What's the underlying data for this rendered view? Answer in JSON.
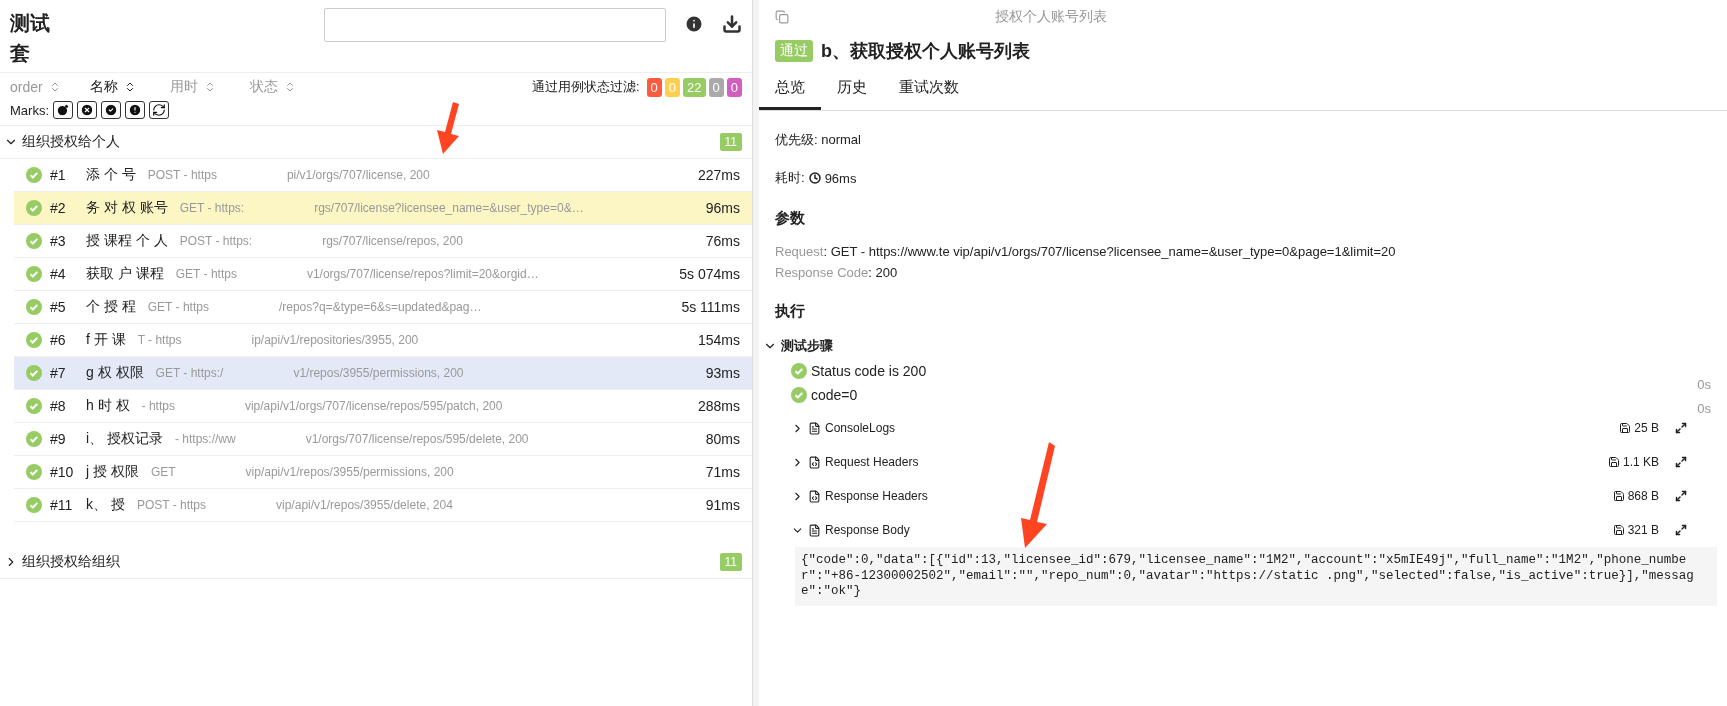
{
  "left": {
    "title": "测试套",
    "sort_columns": [
      {
        "label": "order",
        "selected": false
      },
      {
        "label": "名称",
        "selected": true
      },
      {
        "label": "用时",
        "selected": false
      },
      {
        "label": "状态",
        "selected": false
      }
    ],
    "filter_label": "通过用例状态过滤:",
    "filters": [
      {
        "count": "0",
        "color": "#fd5a3e"
      },
      {
        "count": "0",
        "color": "#ffd050"
      },
      {
        "count": "22",
        "color": "#97cc64"
      },
      {
        "count": "0",
        "color": "#aaaaaa"
      },
      {
        "count": "0",
        "color": "#d35ebe"
      }
    ],
    "marks_label": "Marks:",
    "groups": [
      {
        "name": "组织授权给个人",
        "count": "11",
        "expanded": true,
        "rows": [
          {
            "num": "#1",
            "name": "添 个 号",
            "method": "POST - https",
            "url": "pi/v1/orgs/707/license, 200",
            "time": "227ms",
            "selected": false,
            "hovered": false
          },
          {
            "num": "#2",
            "name": "务 对 权 账号",
            "method": "GET - https:",
            "url": "rgs/707/license?licensee_name=&user_type=0&…",
            "time": "96ms",
            "selected": true,
            "hovered": false
          },
          {
            "num": "#3",
            "name": "授 课程 个 人",
            "method": "POST - https:",
            "url": "rgs/707/license/repos, 200",
            "time": "76ms",
            "selected": false,
            "hovered": false
          },
          {
            "num": "#4",
            "name": "获取 户 课程",
            "method": "GET - https",
            "url": "v1/orgs/707/license/repos?limit=20&orgid…",
            "time": "5s 074ms",
            "selected": false,
            "hovered": false
          },
          {
            "num": "#5",
            "name": "个 授 程",
            "method": "GET - https",
            "url": "/repos?q=&type=6&s=updated&pag…",
            "time": "5s 111ms",
            "selected": false,
            "hovered": false
          },
          {
            "num": "#6",
            "name": "f 开 课",
            "method": "T - https",
            "url": "ip/api/v1/repositories/3955, 200",
            "time": "154ms",
            "selected": false,
            "hovered": false
          },
          {
            "num": "#7",
            "name": "g 权 权限",
            "method": "GET - https:/",
            "url": "v1/repos/3955/permissions, 200",
            "time": "93ms",
            "selected": false,
            "hovered": true
          },
          {
            "num": "#8",
            "name": "h 时 权",
            "method": "- https",
            "url": "vip/api/v1/orgs/707/license/repos/595/patch, 200",
            "time": "288ms",
            "selected": false,
            "hovered": false
          },
          {
            "num": "#9",
            "name": "i、 授权记录",
            "method": "- https://ww",
            "url": "v1/orgs/707/license/repos/595/delete, 200",
            "time": "80ms",
            "selected": false,
            "hovered": false
          },
          {
            "num": "#10",
            "name": "j 授 权限",
            "method": "GET",
            "url": "vip/api/v1/repos/3955/permissions, 200",
            "time": "71ms",
            "selected": false,
            "hovered": false
          },
          {
            "num": "#11",
            "name": "k、 授",
            "method": "POST - https",
            "url": "vip/api/v1/repos/3955/delete, 204",
            "time": "91ms",
            "selected": false,
            "hovered": false
          }
        ]
      },
      {
        "name": "组织授权给组织",
        "count": "11",
        "expanded": false
      }
    ]
  },
  "right": {
    "breadcrumb": "授权个人账号列表",
    "status": "通过",
    "title": "b、获取授权个人账号列表",
    "tabs": [
      {
        "label": "总览",
        "selected": true
      },
      {
        "label": "历史",
        "selected": false
      },
      {
        "label": "重试次数",
        "selected": false
      }
    ],
    "priority_label": "优先级:",
    "priority": "normal",
    "duration_label": "耗时:",
    "duration": "96ms",
    "params_heading": "参数",
    "params": [
      {
        "key": "Request",
        "value": ": GET - https://www.te vip/api/v1/orgs/707/license?licensee_name=&user_type=0&page=1&limit=20"
      },
      {
        "key": "Response Code",
        "value": ": 200"
      }
    ],
    "exec_heading": "执行",
    "steps_heading": "测试步骤",
    "steps_expanded": true,
    "steps": [
      {
        "name": "Status code is 200",
        "time": "0s"
      },
      {
        "name": "code=0",
        "time": "0s"
      }
    ],
    "attachments": [
      {
        "name": "ConsoleLogs",
        "size": "25 B",
        "expanded": false,
        "kind": "text"
      },
      {
        "name": "Request Headers",
        "size": "1.1 KB",
        "expanded": false,
        "kind": "json"
      },
      {
        "name": "Response Headers",
        "size": "868 B",
        "expanded": false,
        "kind": "json"
      },
      {
        "name": "Response Body",
        "size": "321 B",
        "expanded": true,
        "kind": "text"
      }
    ],
    "body": "{\"code\":0,\"data\":[{\"id\":13,\"licensee_id\":679,\"licensee_name\":\"1M2\",\"account\":\"x5mIE49j\",\"full_name\":\"1M2\",\"phone_number\":\"+86-12300002502\",\"email\":\"\",\"repo_num\":0,\"avatar\":\"https://static .png\",\"selected\":false,\"is_active\":true}],\"message\":\"ok\"}"
  }
}
